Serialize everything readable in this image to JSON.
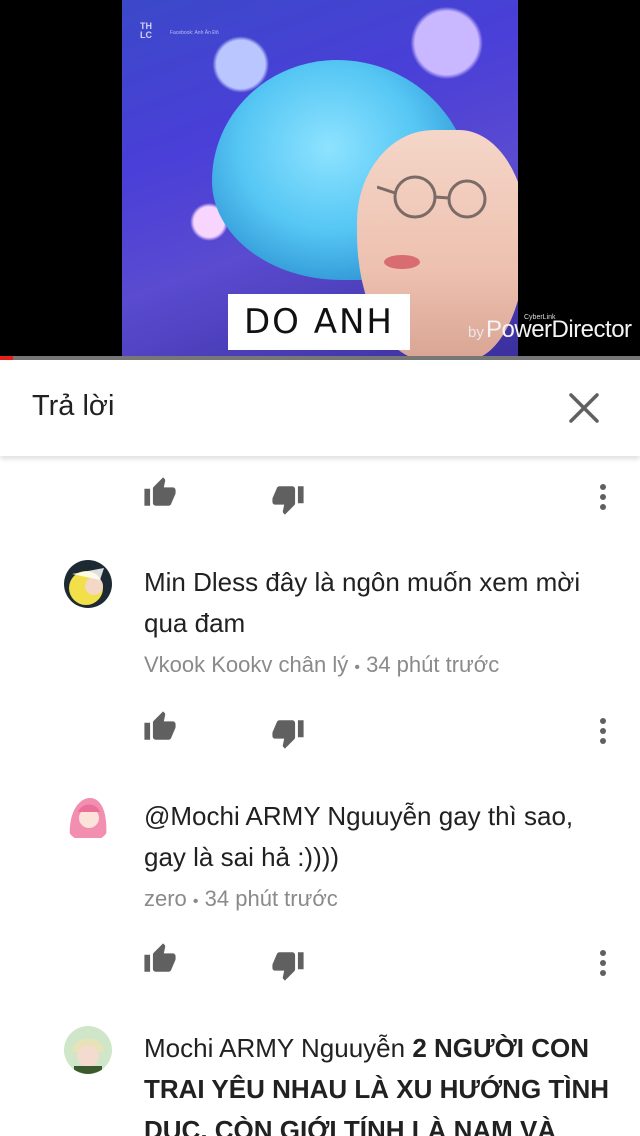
{
  "video": {
    "watermark_top": "TH\nLC",
    "watermark_sub": "Facebook: Anh Ăn Đô",
    "caption": "DO ANH",
    "brand_by": "by",
    "brand_name": "PowerDirector",
    "brand_small": "CyberLink",
    "progress": 0.02
  },
  "reply_header": {
    "title": "Trả lời",
    "close_icon": "close-icon"
  },
  "comments": [
    {
      "author": "Min Dless",
      "text": "đây là ngôn muốn xem mời qua đam",
      "channel": "Vkook Kookv chân lý",
      "separator": "•",
      "time": "34 phút trước"
    },
    {
      "author": "@Mochi ARMY Nguuyễn",
      "text": "gay thì sao, gay là sai hả :))))",
      "channel": "zero",
      "separator": "•",
      "time": "34 phút trước"
    },
    {
      "author": "Mochi ARMY Nguuyễn",
      "text_bold": "2 NGƯỜI CON TRAI YÊU NHAU LÀ XU HƯỚNG TÌNH DỤC, CÒN GIỚI TÍNH LÀ NAM VÀ"
    }
  ],
  "icons": [
    "thumbs-up-icon",
    "thumbs-down-icon",
    "more-vert-icon",
    "close-icon"
  ],
  "colors": {
    "progress": "#e62117",
    "text_primary": "#212121",
    "text_secondary": "#8a8a8a",
    "icon": "#606060"
  }
}
